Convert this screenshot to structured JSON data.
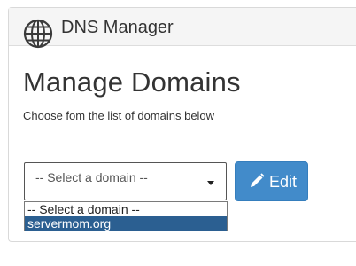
{
  "header": {
    "title": "DNS Manager",
    "icon": "globe-icon"
  },
  "main": {
    "title": "Manage Domains",
    "subtitle": "Choose fom the list of domains below"
  },
  "domain_select": {
    "selected": "-- Select a domain --",
    "options": [
      {
        "label": "-- Select a domain --",
        "highlighted": false
      },
      {
        "label": "servermom.org",
        "highlighted": true
      }
    ]
  },
  "edit_button": {
    "label": "Edit",
    "icon": "pencil-icon",
    "color": "#428bca"
  },
  "colors": {
    "highlight": "#2b5f91",
    "header_bg": "#f5f5f5"
  }
}
